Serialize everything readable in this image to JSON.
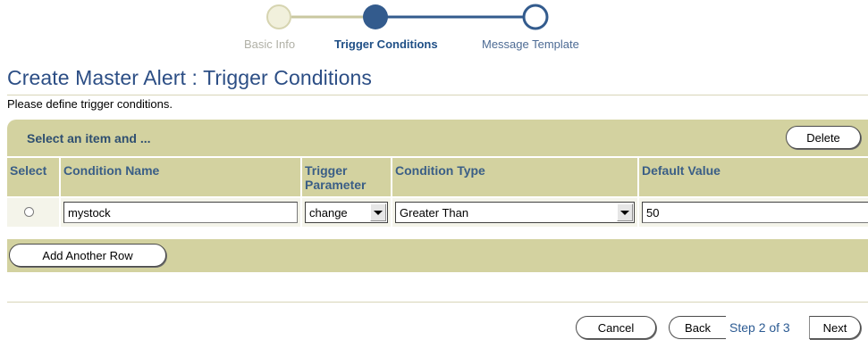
{
  "train": {
    "steps": [
      {
        "label": "Basic Info",
        "state": "done"
      },
      {
        "label": "Trigger Conditions",
        "state": "current"
      },
      {
        "label": "Message Template",
        "state": "next"
      }
    ],
    "colors": {
      "done": "#f1f0dc",
      "current": "#335b8d",
      "next": "#ffffff"
    }
  },
  "page": {
    "title": "Create Master Alert : Trigger Conditions",
    "instruction": "Please define trigger conditions."
  },
  "table": {
    "bar_title": "Select an item and ...",
    "delete_label": "Delete",
    "columns": [
      "Select",
      "Condition Name",
      "Trigger Parameter",
      "Condition Type",
      "Default Value"
    ],
    "rows": [
      {
        "selected": false,
        "condition_name": "mystock",
        "trigger_parameter": "change",
        "condition_type": "Greater Than",
        "default_value": "50"
      }
    ],
    "add_row_label": "Add Another Row"
  },
  "footer": {
    "cancel_label": "Cancel",
    "back_label": "Back",
    "step_text": "Step 2 of 3",
    "next_label": "Next"
  },
  "colors": {
    "title": "#2c4e85",
    "bar": "#d3d2a0",
    "header_text": "#3a5e86"
  }
}
